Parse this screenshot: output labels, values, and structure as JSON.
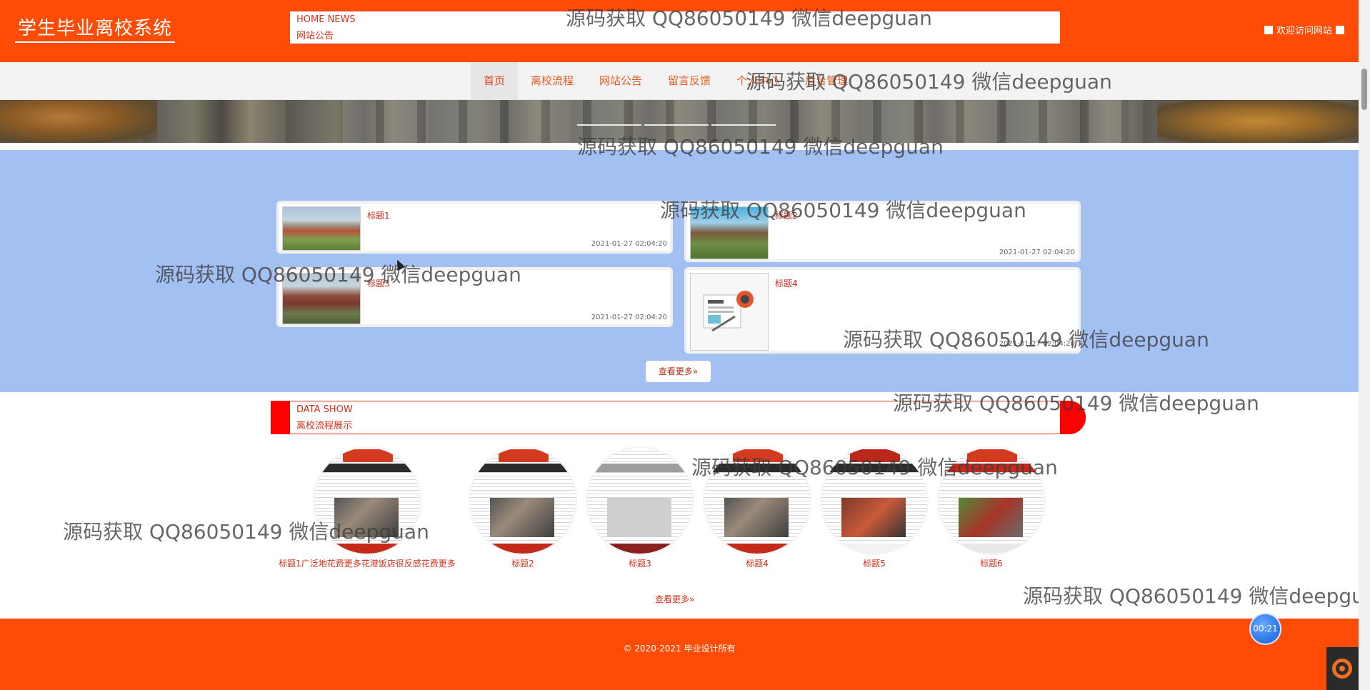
{
  "header": {
    "site_title": "学生毕业离校系统",
    "welcome_text": "欢迎访问网站"
  },
  "nav": {
    "items": [
      {
        "label": "首页",
        "active": true
      },
      {
        "label": "离校流程"
      },
      {
        "label": "网站公告"
      },
      {
        "label": "留言反馈"
      },
      {
        "label": "个人中心"
      },
      {
        "label": "后台管理"
      }
    ]
  },
  "news_section": {
    "en_title": "HOME NEWS",
    "zh_title": "网站公告",
    "items": [
      {
        "title": "标题1",
        "date": "2021-01-27 02:04:20",
        "image": "school-building-thumbnail"
      },
      {
        "title": "标题2",
        "date": "2021-01-27 02:04:20",
        "image": "school-building-thumbnail"
      },
      {
        "title": "标题3",
        "date": "2021-01-27 02:04:20",
        "image": "school-building-thumbnail"
      },
      {
        "title": "标题4",
        "date": "2021-01-27 02:04:20",
        "image": "news-icon-thumbnail"
      }
    ],
    "more_label": "查看更多»"
  },
  "data_section": {
    "en_title": "DATA SHOW",
    "zh_title": "离校流程展示",
    "items": [
      {
        "title": "标题1广泛地花费更多花港饭店很反感花费更多"
      },
      {
        "title": "标题2"
      },
      {
        "title": "标题3"
      },
      {
        "title": "标题4"
      },
      {
        "title": "标题5"
      },
      {
        "title": "标题6"
      }
    ],
    "more_label": "查看更多»"
  },
  "footer": {
    "copyright": "© 2020-2021 毕业设计所有"
  },
  "widgets": {
    "timer": "00:21"
  },
  "watermark": "源码获取 QQ86050149 微信deepguan",
  "colors": {
    "primary": "#fe4b06",
    "news_bg": "#a3c0f3",
    "accent_text": "#d2311a"
  }
}
